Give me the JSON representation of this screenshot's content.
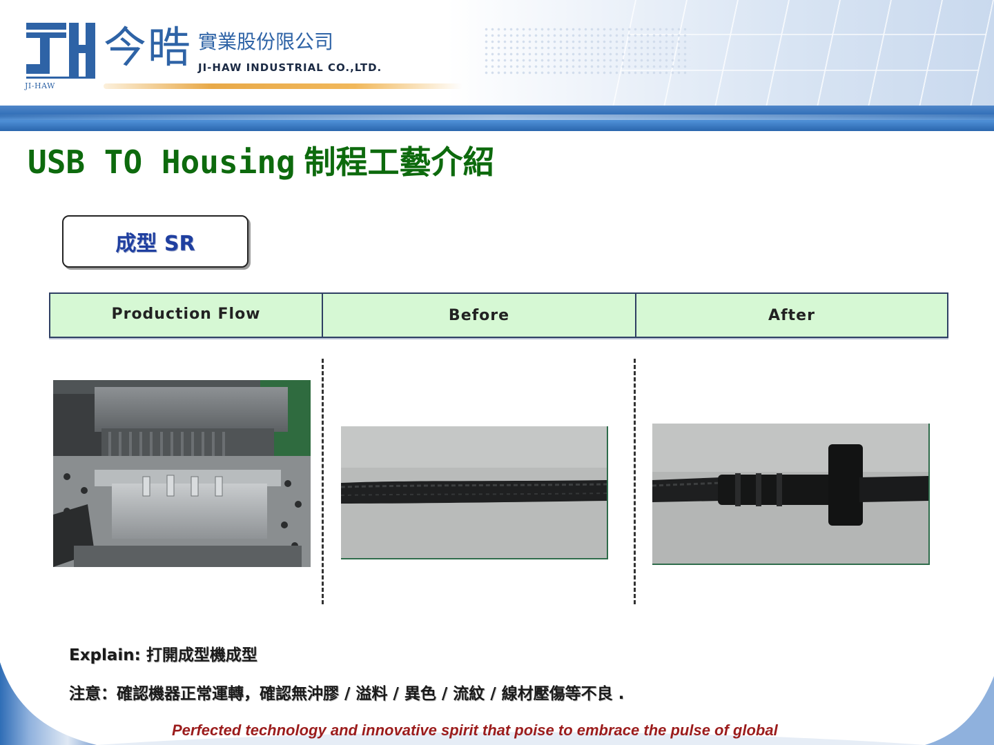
{
  "header": {
    "logo_cn": "今晧",
    "logo_small": "JI-HAW",
    "company_cn": "實業股份限公司",
    "company_en": "JI-HAW INDUSTRIAL CO.,LTD."
  },
  "title": {
    "en": "USB TO Housing",
    "cn": "制程工藝介紹"
  },
  "step_label": "成型 SR",
  "table_headers": {
    "flow": "Production Flow",
    "before": "Before",
    "after": "After"
  },
  "explain": "Explain: 打開成型機成型",
  "notice": "注意：確認機器正常運轉，確認無沖膠 / 溢料 / 異色 / 流紋 / 線材壓傷等不良 .",
  "slogan": "Perfected technology and innovative spirit that poise to embrace the pulse of global",
  "colors": {
    "title_green": "#0d6a0d",
    "brand_blue": "#2e63a6",
    "header_green": "#d6f8d4",
    "slogan_red": "#9b1c1c"
  }
}
